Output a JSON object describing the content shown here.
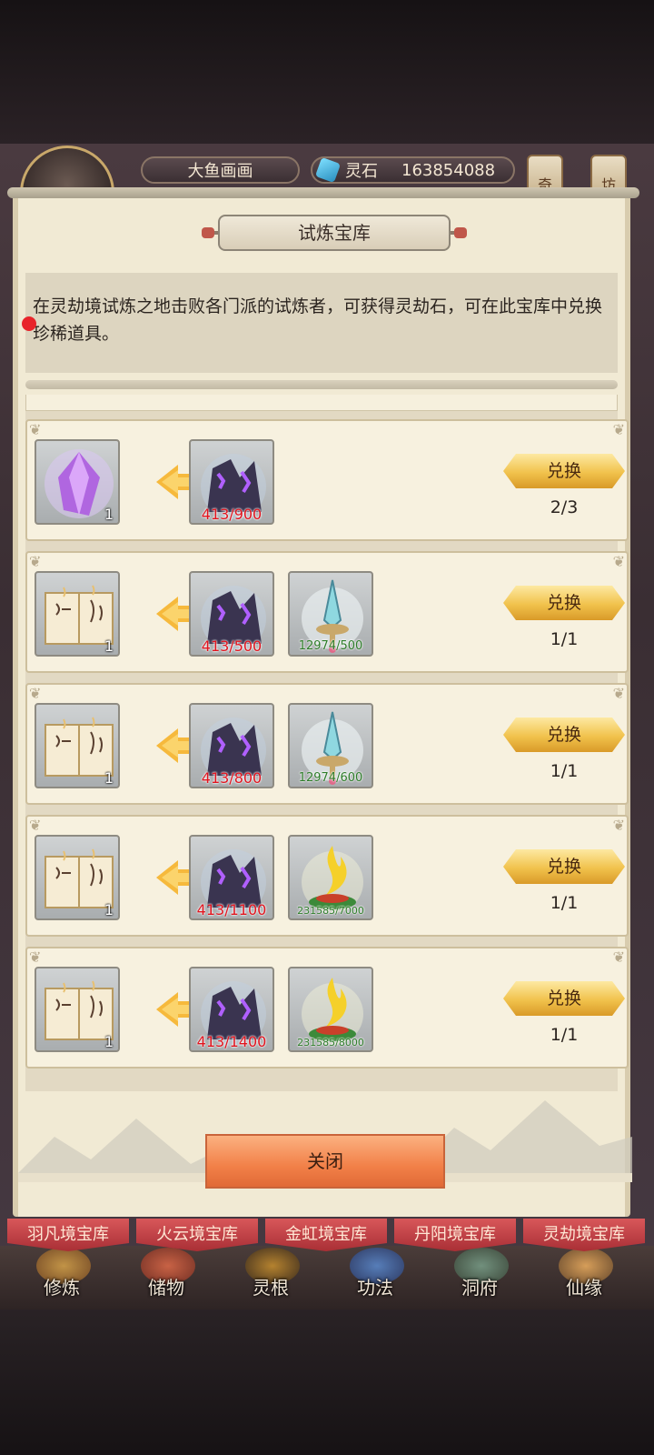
{
  "hud": {
    "player_name": "大鱼画画",
    "currency_label": "灵石",
    "currency_value": "163854088",
    "side_tab_1": "奇",
    "side_tab_2": "坊"
  },
  "dialog": {
    "title": "试炼宝库",
    "description": "在灵劫境试炼之地击败各门派的试炼者，可获得灵劫石，可在此宝库中兑换珍稀道具。",
    "close_label": "关闭"
  },
  "exchange_rows": [
    {
      "reward_icon": "purple-crystal-icon",
      "reward_count": "1",
      "costs": [
        {
          "icon": "spirit-stone-rock-icon",
          "progress": "413/900",
          "color": "red"
        }
      ],
      "button_label": "兑换",
      "remaining": "2/3"
    },
    {
      "reward_icon": "skill-book-icon",
      "reward_count": "1",
      "costs": [
        {
          "icon": "spirit-stone-rock-icon",
          "progress": "413/500",
          "color": "red"
        },
        {
          "icon": "jade-sword-icon",
          "progress": "12974/500",
          "color": "green"
        }
      ],
      "button_label": "兑换",
      "remaining": "1/1"
    },
    {
      "reward_icon": "skill-book-icon",
      "reward_count": "1",
      "costs": [
        {
          "icon": "spirit-stone-rock-icon",
          "progress": "413/800",
          "color": "red"
        },
        {
          "icon": "jade-sword-icon",
          "progress": "12974/600",
          "color": "green"
        }
      ],
      "button_label": "兑换",
      "remaining": "1/1"
    },
    {
      "reward_icon": "skill-book-icon",
      "reward_count": "1",
      "costs": [
        {
          "icon": "spirit-stone-rock-icon",
          "progress": "413/1100",
          "color": "red"
        },
        {
          "icon": "golden-flame-icon",
          "progress": "231585/7000",
          "color": "green"
        }
      ],
      "button_label": "兑换",
      "remaining": "1/1"
    },
    {
      "reward_icon": "skill-book-icon",
      "reward_count": "1",
      "costs": [
        {
          "icon": "spirit-stone-rock-icon",
          "progress": "413/1400",
          "color": "red"
        },
        {
          "icon": "golden-flame-icon",
          "progress": "231585/8000",
          "color": "green"
        }
      ],
      "button_label": "兑换",
      "remaining": "1/1"
    }
  ],
  "treasury_tabs": [
    "羽凡境宝库",
    "火云境宝库",
    "金虹境宝库",
    "丹阳境宝库",
    "灵劫境宝库"
  ],
  "bottom_nav": [
    "修炼",
    "储物",
    "灵根",
    "功法",
    "洞府",
    "仙缘"
  ],
  "colors": {
    "panel_bg": "#f1ead4",
    "button_gold": "#f1c24c",
    "close_orange": "#f28048",
    "tab_red": "#a92f35",
    "shortfall_red": "#e0141e",
    "surplus_green": "#2e7d2a"
  }
}
